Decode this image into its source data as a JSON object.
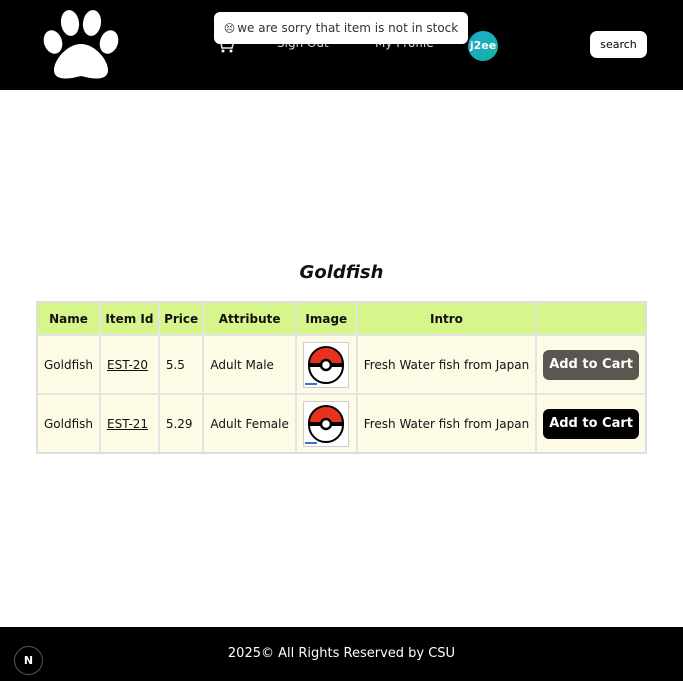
{
  "header": {
    "logo_icon": "paw-print-icon",
    "cart_icon": "cart-icon",
    "nav": {
      "sign_out": "Sign Out",
      "my_profile": "My Profile"
    },
    "avatar_text": "j2ee",
    "search_label": "search"
  },
  "toast": {
    "icon": "sad-face-icon",
    "message": "we are sorry that item is not in stock"
  },
  "main": {
    "title": "Goldfish",
    "table": {
      "headers": [
        "Name",
        "Item Id",
        "Price",
        "Attribute",
        "Image",
        "Intro",
        ""
      ],
      "rows": [
        {
          "name": "Goldfish",
          "item_id": "EST-20",
          "price": "5.5",
          "attribute": "Adult Male",
          "image_icon": "pokeball-icon",
          "intro": "Fresh Water fish from Japan",
          "action": "Add to Cart"
        },
        {
          "name": "Goldfish",
          "item_id": "EST-21",
          "price": "5.29",
          "attribute": "Adult Female",
          "image_icon": "pokeball-icon",
          "intro": "Fresh Water fish from Japan",
          "action": "Add to Cart"
        }
      ]
    }
  },
  "footer": {
    "text": "2025© All Rights Reserved by CSU"
  },
  "next_badge": "N",
  "colors": {
    "header_bg": "#000000",
    "table_header_bg": "#d6f58a",
    "table_body_bg": "#fdfbe6",
    "button_dark": "#000000",
    "button_muted": "#5b5650"
  }
}
